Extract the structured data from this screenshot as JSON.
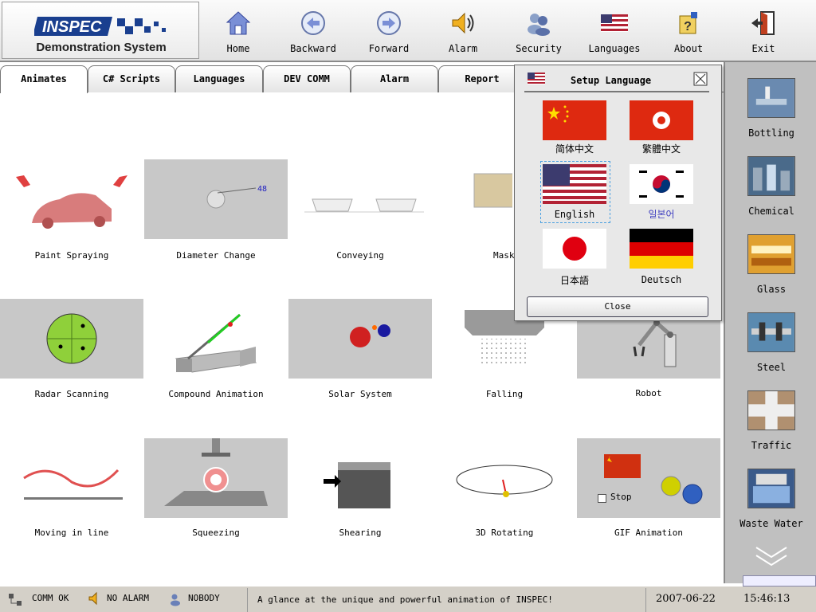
{
  "logo": {
    "brand": "INSPEC",
    "subtitle": "Demonstration System"
  },
  "toolbar": [
    {
      "label": "Home",
      "icon": "home-icon"
    },
    {
      "label": "Backward",
      "icon": "arrow-left-icon"
    },
    {
      "label": "Forward",
      "icon": "arrow-right-icon"
    },
    {
      "label": "Alarm",
      "icon": "speaker-icon"
    },
    {
      "label": "Security",
      "icon": "users-icon"
    },
    {
      "label": "Languages",
      "icon": "us-flag-icon"
    },
    {
      "label": "About",
      "icon": "help-icon"
    },
    {
      "label": "Exit",
      "icon": "exit-icon"
    }
  ],
  "tabs": [
    {
      "label": "Animates",
      "active": true
    },
    {
      "label": "C# Scripts"
    },
    {
      "label": "Languages"
    },
    {
      "label": "DEV COMM"
    },
    {
      "label": "Alarm"
    },
    {
      "label": "Report"
    }
  ],
  "grid": [
    {
      "label": "Paint Spraying"
    },
    {
      "label": "Diameter Change",
      "value": "48"
    },
    {
      "label": "Conveying"
    },
    {
      "label": "Mask"
    },
    {
      "label": "Radar Scanning"
    },
    {
      "label": "Compound Animation"
    },
    {
      "label": "Solar System"
    },
    {
      "label": "Falling"
    },
    {
      "label": "Robot"
    },
    {
      "label": "Moving in line"
    },
    {
      "label": "Squeezing"
    },
    {
      "label": "Shearing"
    },
    {
      "label": "3D Rotating"
    },
    {
      "label": "GIF Animation",
      "checkbox": "Stop"
    }
  ],
  "sidebar": [
    {
      "label": "Bottling"
    },
    {
      "label": "Chemical"
    },
    {
      "label": "Glass"
    },
    {
      "label": "Steel"
    },
    {
      "label": "Traffic"
    },
    {
      "label": "Waste Water"
    }
  ],
  "dialog": {
    "title": "Setup Language",
    "close_label": "Close",
    "languages": [
      {
        "label": "简体中文",
        "flag": "cn-flag-icon"
      },
      {
        "label": "繁體中文",
        "flag": "hk-flag-icon"
      },
      {
        "label": "English",
        "flag": "us-flag-icon",
        "selected": true
      },
      {
        "label": "일본어",
        "flag": "kr-flag-icon",
        "color": "#4040c0"
      },
      {
        "label": "日本語",
        "flag": "jp-flag-icon"
      },
      {
        "label": "Deutsch",
        "flag": "de-flag-icon"
      }
    ]
  },
  "status": {
    "comm": "COMM OK",
    "alarm": "NO ALARM",
    "user": "NOBODY",
    "message": "A glance at the unique and powerful animation of INSPEC!",
    "date": "2007-06-22",
    "time": "15:46:13"
  },
  "colors": {
    "accent": "#1a3f8f",
    "tab_border": "#777777",
    "sidebar_bg": "#c0c0c0",
    "status_bg": "#d4d0c8"
  }
}
